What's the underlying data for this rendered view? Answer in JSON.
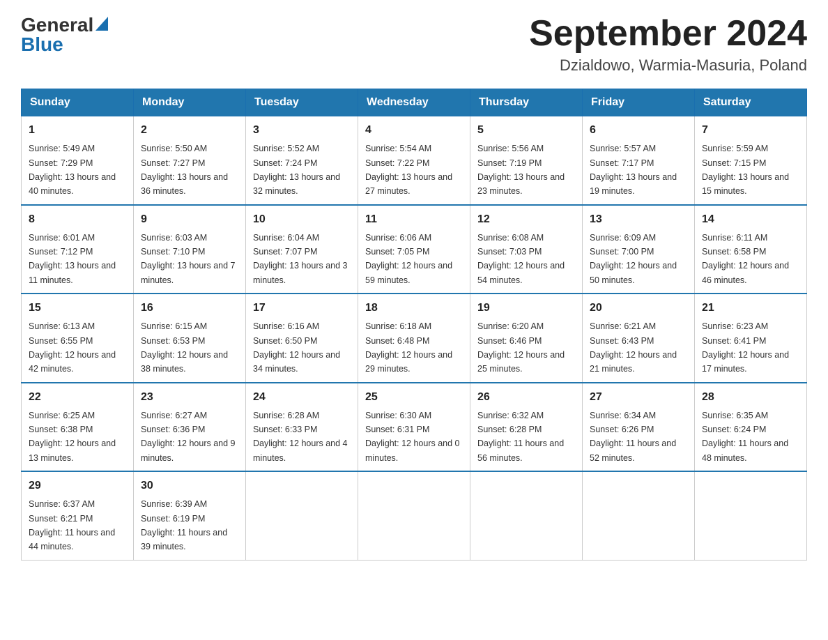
{
  "header": {
    "logo_part1": "General",
    "logo_part2": "Blue",
    "month_title": "September 2024",
    "location": "Dzialdowo, Warmia-Masuria, Poland"
  },
  "days_of_week": [
    "Sunday",
    "Monday",
    "Tuesday",
    "Wednesday",
    "Thursday",
    "Friday",
    "Saturday"
  ],
  "weeks": [
    [
      {
        "day": "1",
        "sunrise": "5:49 AM",
        "sunset": "7:29 PM",
        "daylight": "13 hours and 40 minutes."
      },
      {
        "day": "2",
        "sunrise": "5:50 AM",
        "sunset": "7:27 PM",
        "daylight": "13 hours and 36 minutes."
      },
      {
        "day": "3",
        "sunrise": "5:52 AM",
        "sunset": "7:24 PM",
        "daylight": "13 hours and 32 minutes."
      },
      {
        "day": "4",
        "sunrise": "5:54 AM",
        "sunset": "7:22 PM",
        "daylight": "13 hours and 27 minutes."
      },
      {
        "day": "5",
        "sunrise": "5:56 AM",
        "sunset": "7:19 PM",
        "daylight": "13 hours and 23 minutes."
      },
      {
        "day": "6",
        "sunrise": "5:57 AM",
        "sunset": "7:17 PM",
        "daylight": "13 hours and 19 minutes."
      },
      {
        "day": "7",
        "sunrise": "5:59 AM",
        "sunset": "7:15 PM",
        "daylight": "13 hours and 15 minutes."
      }
    ],
    [
      {
        "day": "8",
        "sunrise": "6:01 AM",
        "sunset": "7:12 PM",
        "daylight": "13 hours and 11 minutes."
      },
      {
        "day": "9",
        "sunrise": "6:03 AM",
        "sunset": "7:10 PM",
        "daylight": "13 hours and 7 minutes."
      },
      {
        "day": "10",
        "sunrise": "6:04 AM",
        "sunset": "7:07 PM",
        "daylight": "13 hours and 3 minutes."
      },
      {
        "day": "11",
        "sunrise": "6:06 AM",
        "sunset": "7:05 PM",
        "daylight": "12 hours and 59 minutes."
      },
      {
        "day": "12",
        "sunrise": "6:08 AM",
        "sunset": "7:03 PM",
        "daylight": "12 hours and 54 minutes."
      },
      {
        "day": "13",
        "sunrise": "6:09 AM",
        "sunset": "7:00 PM",
        "daylight": "12 hours and 50 minutes."
      },
      {
        "day": "14",
        "sunrise": "6:11 AM",
        "sunset": "6:58 PM",
        "daylight": "12 hours and 46 minutes."
      }
    ],
    [
      {
        "day": "15",
        "sunrise": "6:13 AM",
        "sunset": "6:55 PM",
        "daylight": "12 hours and 42 minutes."
      },
      {
        "day": "16",
        "sunrise": "6:15 AM",
        "sunset": "6:53 PM",
        "daylight": "12 hours and 38 minutes."
      },
      {
        "day": "17",
        "sunrise": "6:16 AM",
        "sunset": "6:50 PM",
        "daylight": "12 hours and 34 minutes."
      },
      {
        "day": "18",
        "sunrise": "6:18 AM",
        "sunset": "6:48 PM",
        "daylight": "12 hours and 29 minutes."
      },
      {
        "day": "19",
        "sunrise": "6:20 AM",
        "sunset": "6:46 PM",
        "daylight": "12 hours and 25 minutes."
      },
      {
        "day": "20",
        "sunrise": "6:21 AM",
        "sunset": "6:43 PM",
        "daylight": "12 hours and 21 minutes."
      },
      {
        "day": "21",
        "sunrise": "6:23 AM",
        "sunset": "6:41 PM",
        "daylight": "12 hours and 17 minutes."
      }
    ],
    [
      {
        "day": "22",
        "sunrise": "6:25 AM",
        "sunset": "6:38 PM",
        "daylight": "12 hours and 13 minutes."
      },
      {
        "day": "23",
        "sunrise": "6:27 AM",
        "sunset": "6:36 PM",
        "daylight": "12 hours and 9 minutes."
      },
      {
        "day": "24",
        "sunrise": "6:28 AM",
        "sunset": "6:33 PM",
        "daylight": "12 hours and 4 minutes."
      },
      {
        "day": "25",
        "sunrise": "6:30 AM",
        "sunset": "6:31 PM",
        "daylight": "12 hours and 0 minutes."
      },
      {
        "day": "26",
        "sunrise": "6:32 AM",
        "sunset": "6:28 PM",
        "daylight": "11 hours and 56 minutes."
      },
      {
        "day": "27",
        "sunrise": "6:34 AM",
        "sunset": "6:26 PM",
        "daylight": "11 hours and 52 minutes."
      },
      {
        "day": "28",
        "sunrise": "6:35 AM",
        "sunset": "6:24 PM",
        "daylight": "11 hours and 48 minutes."
      }
    ],
    [
      {
        "day": "29",
        "sunrise": "6:37 AM",
        "sunset": "6:21 PM",
        "daylight": "11 hours and 44 minutes."
      },
      {
        "day": "30",
        "sunrise": "6:39 AM",
        "sunset": "6:19 PM",
        "daylight": "11 hours and 39 minutes."
      },
      null,
      null,
      null,
      null,
      null
    ]
  ]
}
